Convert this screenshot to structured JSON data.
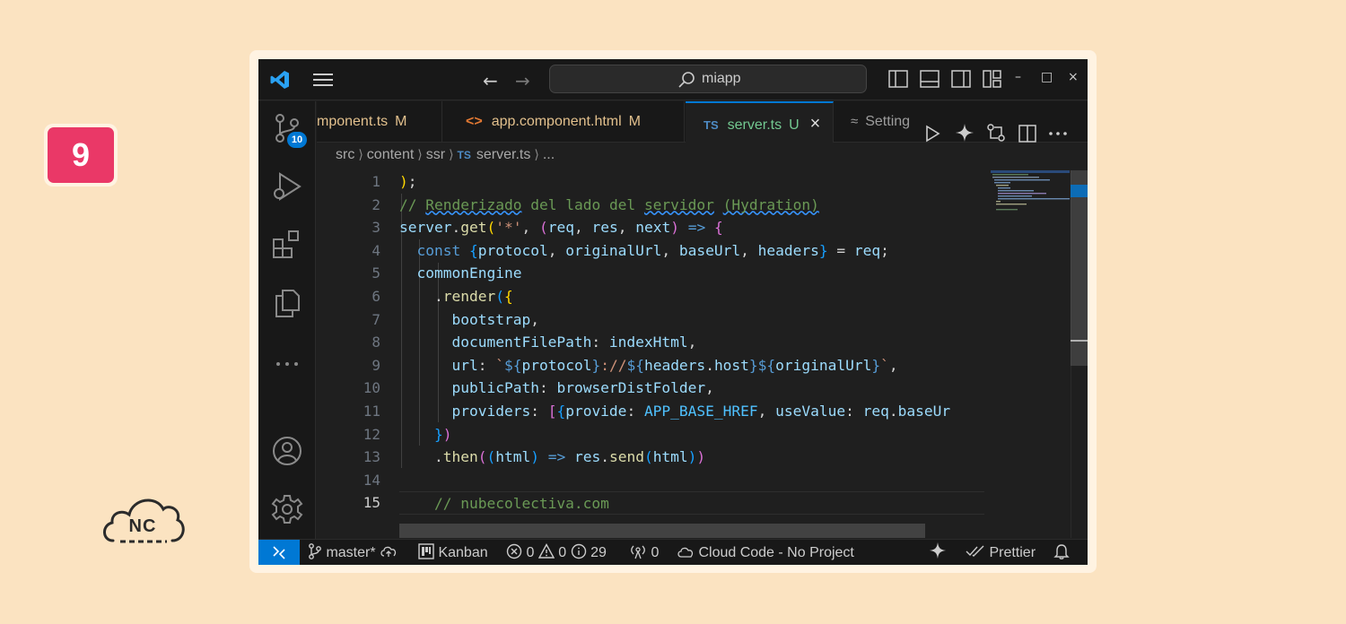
{
  "step_badge": "9",
  "brand_logo_text": "NC",
  "titlebar": {
    "search_text": "miapp",
    "icons": [
      "vscode-logo-icon",
      "hamburger-menu-icon",
      "arrow-left-icon",
      "arrow-right-icon",
      "search-icon",
      "toggle-primary-sidebar-icon",
      "toggle-panel-icon",
      "toggle-secondary-sidebar-icon",
      "customize-layout-icon"
    ],
    "window_controls": {
      "minimize": "–",
      "maximize": "□",
      "close": "×"
    }
  },
  "activity_bar": {
    "source_control_badge": "10",
    "items": [
      "source-control-icon",
      "run-debug-icon",
      "extensions-icon",
      "explorer-icon",
      "more-icon",
      "account-icon",
      "settings-gear-icon"
    ]
  },
  "tabs": [
    {
      "label": "mponent.ts",
      "status": "M",
      "icon": "ts-icon"
    },
    {
      "label": "app.component.html",
      "status": "M",
      "icon": "html-icon"
    },
    {
      "label": "server.ts",
      "status": "U",
      "icon": "ts-icon",
      "active": true,
      "icon_text": "TS",
      "close": "×"
    },
    {
      "label": "Setting",
      "icon": "settings-icon"
    }
  ],
  "breadcrumb": {
    "parts": [
      "src",
      "content",
      "ssr"
    ],
    "file_icon": "TS",
    "file": "server.ts",
    "more": "..."
  },
  "line_numbers": [
    "1",
    "2",
    "3",
    "4",
    "5",
    "6",
    "7",
    "8",
    "9",
    "10",
    "11",
    "12",
    "13",
    "14",
    "15"
  ],
  "code_lines": [
    ");",
    "// Renderizado del lado del servidor (Hydration)",
    "server.get('*', (req, res, next) => {",
    "  const {protocol, originalUrl, baseUrl, headers} = req;",
    "  commonEngine",
    "    .render({",
    "      bootstrap,",
    "      documentFilePath: indexHtml,",
    "      url: `${protocol}://${headers.host}${originalUrl}`,",
    "      publicPath: browserDistFolder,",
    "      providers: [{provide: APP_BASE_HREF, useValue: req.baseUr",
    "    })",
    "    .then((html) => res.send(html))",
    "",
    "    // nubecolectiva.com"
  ],
  "status_bar": {
    "branch": "master*",
    "kanban": "Kanban",
    "errors": "0",
    "warnings": "0",
    "infos": "29",
    "ports": "0",
    "cloud_code": "Cloud Code - No Project",
    "prettier": "Prettier"
  },
  "colors": {
    "accent": "#0078d4",
    "background": "#fbe3c1",
    "badge": "#ea3867",
    "editor_bg": "#1f1f1f",
    "modified": "#e2c08d",
    "untracked": "#73c991"
  }
}
